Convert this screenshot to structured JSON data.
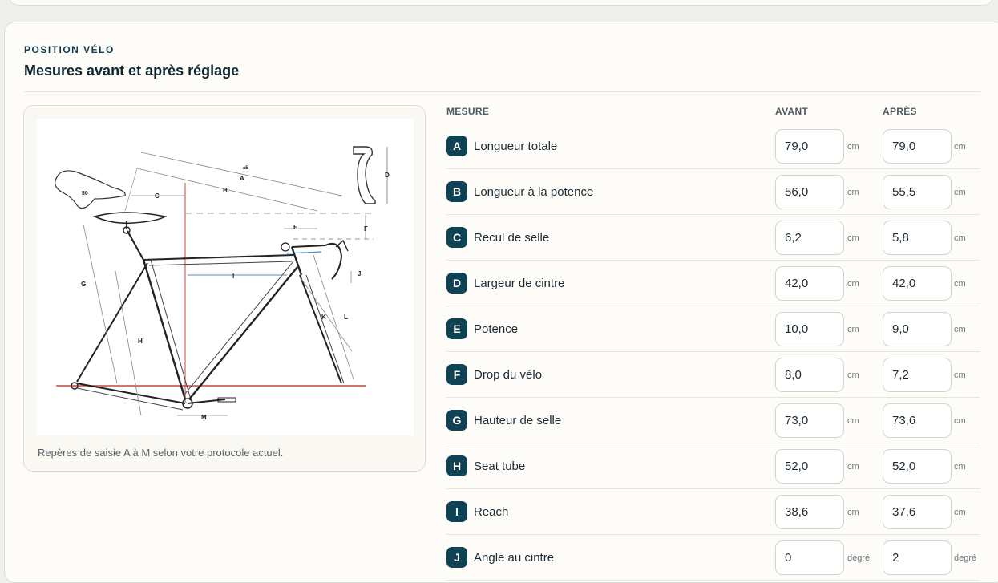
{
  "section": {
    "eyebrow": "POSITION VÉLO",
    "title": "Mesures avant et après réglage"
  },
  "figure": {
    "caption": "Repères de saisie A à M selon votre protocole actuel.",
    "saddle_label": "80",
    "tolerance_label": "±5",
    "letters": [
      "A",
      "B",
      "C",
      "D",
      "E",
      "F",
      "G",
      "H",
      "I",
      "J",
      "K",
      "L",
      "M"
    ]
  },
  "table": {
    "headers": {
      "measure": "MESURE",
      "before": "AVANT",
      "after": "APRÈS"
    },
    "rows": [
      {
        "letter": "A",
        "label": "Longueur totale",
        "before": "79,0",
        "after": "79,0",
        "unit": "cm"
      },
      {
        "letter": "B",
        "label": "Longueur à la potence",
        "before": "56,0",
        "after": "55,5",
        "unit": "cm"
      },
      {
        "letter": "C",
        "label": "Recul de selle",
        "before": "6,2",
        "after": "5,8",
        "unit": "cm"
      },
      {
        "letter": "D",
        "label": "Largeur de cintre",
        "before": "42,0",
        "after": "42,0",
        "unit": "cm"
      },
      {
        "letter": "E",
        "label": "Potence",
        "before": "10,0",
        "after": "9,0",
        "unit": "cm"
      },
      {
        "letter": "F",
        "label": "Drop du vélo",
        "before": "8,0",
        "after": "7,2",
        "unit": "cm"
      },
      {
        "letter": "G",
        "label": "Hauteur de selle",
        "before": "73,0",
        "after": "73,6",
        "unit": "cm"
      },
      {
        "letter": "H",
        "label": "Seat tube",
        "before": "52,0",
        "after": "52,0",
        "unit": "cm"
      },
      {
        "letter": "I",
        "label": "Reach",
        "before": "38,6",
        "after": "37,6",
        "unit": "cm"
      },
      {
        "letter": "J",
        "label": "Angle au cintre",
        "before": "0",
        "after": "2",
        "unit": "degré"
      }
    ]
  }
}
